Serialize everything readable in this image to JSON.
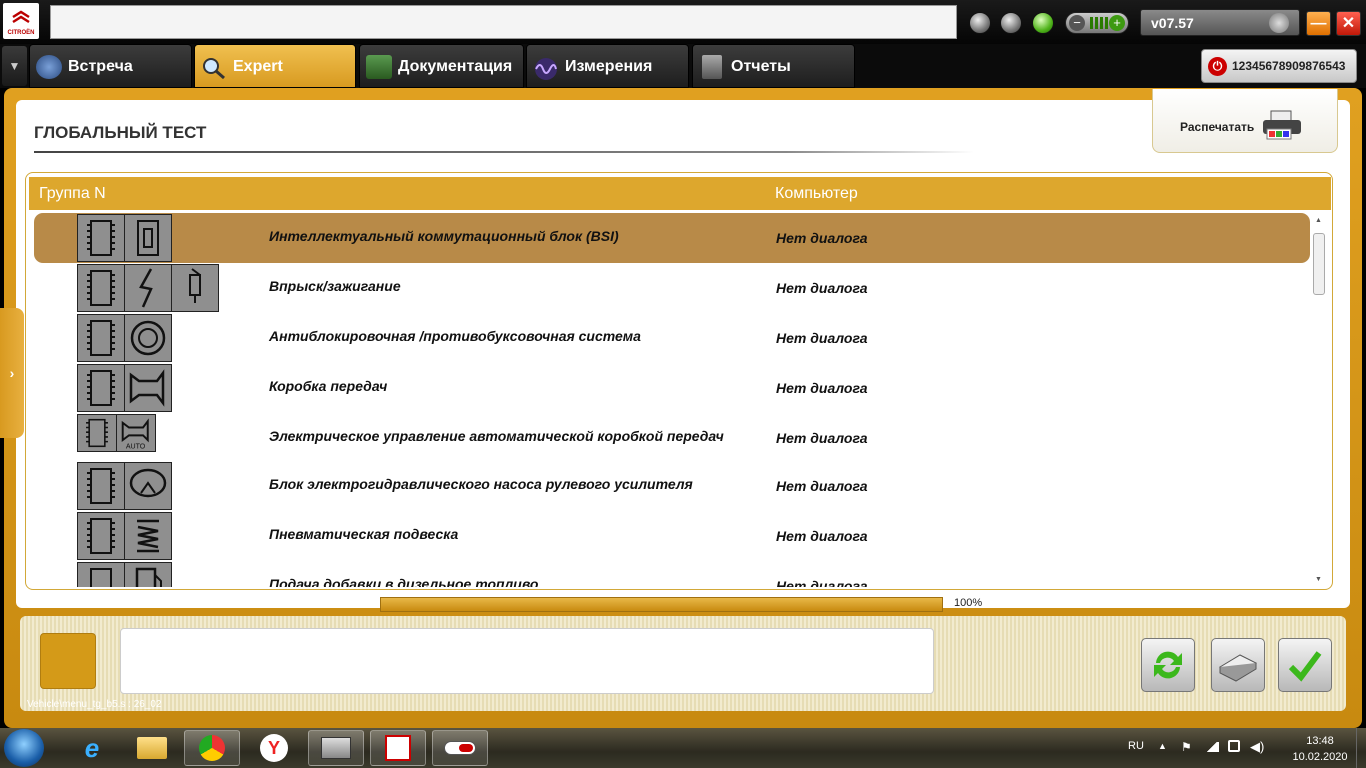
{
  "app": {
    "logo_text": "CITROËN",
    "version": "v07.57",
    "serial": "12345678909876543"
  },
  "tabs": [
    {
      "label": "Встреча",
      "icon": "meeting-icon",
      "active": false
    },
    {
      "label": "Expert",
      "icon": "magnifier-icon",
      "active": true
    },
    {
      "label": "Документация",
      "icon": "book-icon",
      "active": false
    },
    {
      "label": "Измерения",
      "icon": "wave-icon",
      "active": false
    },
    {
      "label": "Отчеты",
      "icon": "report-icon",
      "active": false
    }
  ],
  "page": {
    "title": "ГЛОБАЛЬНЫЙ ТЕСТ",
    "print_label": "Распечатать"
  },
  "table": {
    "col1": "Группа N",
    "col2": "Компьютер",
    "rows": [
      {
        "name": "Интеллектуальный коммутационный блок (BSI)",
        "status": "Нет диалога",
        "icons": [
          "chip-icon",
          "fuse-icon"
        ],
        "selected": true
      },
      {
        "name": "Впрыск/зажигание",
        "status": "Нет диалога",
        "icons": [
          "chip-icon",
          "lightning-icon",
          "injector-icon"
        ],
        "selected": false
      },
      {
        "name": "Антиблокировочная /противобуксовочная система",
        "status": "Нет диалога",
        "icons": [
          "chip-icon",
          "abs-icon"
        ],
        "selected": false
      },
      {
        "name": "Коробка передач",
        "status": "Нет диалога",
        "icons": [
          "chip-icon",
          "gearbox-icon"
        ],
        "selected": false
      },
      {
        "name": "Электрическое управление автоматической коробкой передач",
        "status": "Нет диалога",
        "icons": [
          "chip-icon",
          "auto-gearbox-icon"
        ],
        "selected": false,
        "small": true
      },
      {
        "name": "Блок электрогидравлического насоса рулевого усилителя",
        "status": "Нет диалога",
        "icons": [
          "chip-icon",
          "steering-icon"
        ],
        "selected": false
      },
      {
        "name": "Пневматическая подвеска",
        "status": "Нет диалога",
        "icons": [
          "chip-icon",
          "suspension-icon"
        ],
        "selected": false
      },
      {
        "name": "Подача добавки в дизельное топливо",
        "status": "Нет диалога",
        "icons": [
          "chip-icon",
          "fuel-icon"
        ],
        "selected": false
      }
    ]
  },
  "progress": {
    "value": 100,
    "label": "100%"
  },
  "bottom": {
    "path": "Vehicle\\menu_tg_b5.s : 26_02",
    "message": ""
  },
  "taskbar": {
    "lang": "RU",
    "time": "13:48",
    "date": "10.02.2020"
  }
}
